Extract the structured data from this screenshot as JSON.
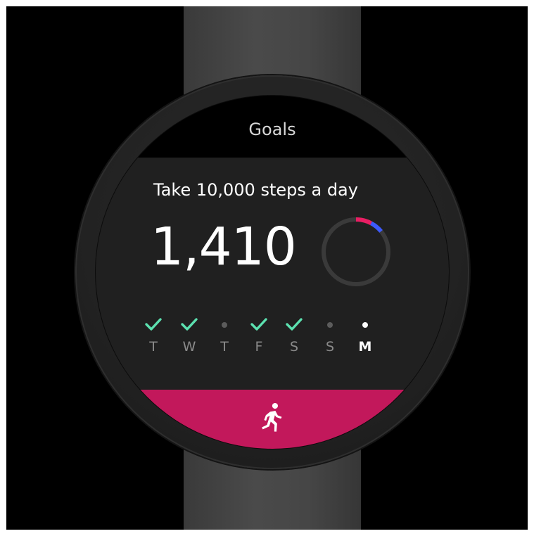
{
  "screen": {
    "title": "Goals"
  },
  "goal": {
    "description": "Take 10,000 steps a day",
    "step_count": "1,410",
    "progress_fraction": 0.141,
    "ring_colors": {
      "track": "#3a3a3a",
      "primary": "#e91e63",
      "secondary": "#3d5afe"
    }
  },
  "week": {
    "days": [
      {
        "label": "T",
        "status": "done"
      },
      {
        "label": "W",
        "status": "done"
      },
      {
        "label": "T",
        "status": "missed"
      },
      {
        "label": "F",
        "status": "done"
      },
      {
        "label": "S",
        "status": "done"
      },
      {
        "label": "S",
        "status": "missed"
      },
      {
        "label": "M",
        "status": "today"
      }
    ],
    "done_color": "#5ce1b0"
  },
  "action": {
    "icon": "running-person-icon",
    "color": "#c2185b"
  }
}
